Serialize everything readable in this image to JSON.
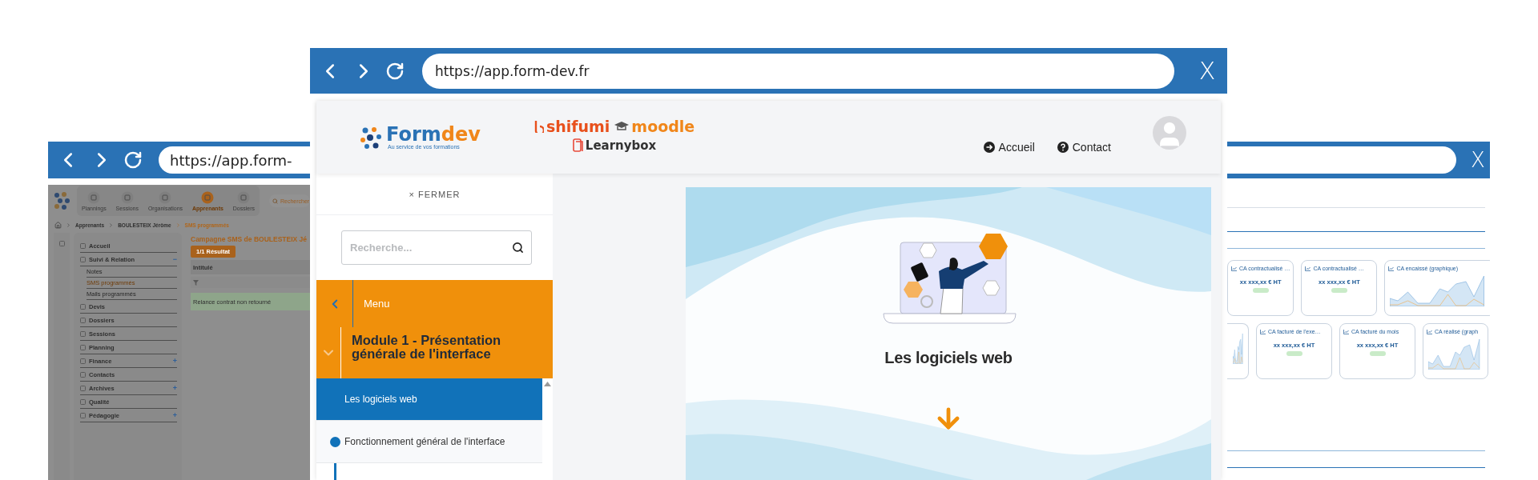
{
  "back_window": {
    "url": "https://app.form-",
    "close": "X",
    "left_app": {
      "nav": [
        {
          "label": "Plannings",
          "selected": false
        },
        {
          "label": "Sessions",
          "selected": false
        },
        {
          "label": "Organisations",
          "selected": false
        },
        {
          "label": "Apprenants",
          "selected": true
        },
        {
          "label": "Dossiers",
          "selected": false
        }
      ],
      "search_placeholder": "Rechercher",
      "breadcrumb": [
        {
          "label": "Apprenants",
          "selected": false
        },
        {
          "label": "BOULESTEIX Jérôme",
          "selected": false
        },
        {
          "label": "SMS programmés",
          "selected": true
        }
      ],
      "sidebar": [
        {
          "label": "Accueil"
        },
        {
          "label": "Suivi & Relation",
          "toggle": "−",
          "children": [
            {
              "label": "Notes",
              "selected": false
            },
            {
              "label": "SMS programmés",
              "selected": true
            },
            {
              "label": "Mails programmés",
              "selected": false
            }
          ]
        },
        {
          "label": "Devis"
        },
        {
          "label": "Dossiers"
        },
        {
          "label": "Sessions"
        },
        {
          "label": "Planning"
        },
        {
          "label": "Finance",
          "toggle": "+"
        },
        {
          "label": "Contacts"
        },
        {
          "label": "Archives",
          "toggle": "+"
        },
        {
          "label": "Qualité"
        },
        {
          "label": "Pédagogie",
          "toggle": "+"
        }
      ],
      "title": "Campagne SMS de BOULESTEIX Jé",
      "result_button": "1/1 Résultat",
      "table": {
        "columns": [
          "Intitulé"
        ],
        "rows": [
          {
            "cells": [
              "Relance contrat non retourné"
            ],
            "selected": true
          }
        ]
      }
    },
    "right_app": {
      "card_rows": [
        [
          {
            "kind": "value",
            "title": "CA contractualisé …",
            "value": "xx xxx,xx € HT"
          },
          {
            "kind": "value",
            "title": "CA contractualisé …",
            "value": "xx xxx,xx € HT"
          },
          {
            "kind": "chart",
            "title": "CA encaissé (graphique)"
          }
        ],
        [
          {
            "kind": "chart"
          },
          {
            "kind": "value",
            "title": "CA facturé de l'exe…",
            "value": "xx xxx,xx € HT"
          },
          {
            "kind": "value",
            "title": "CA facturé du mois",
            "value": "xx xxx,xx € HT"
          },
          {
            "kind": "chart",
            "title": "CA réalisé (graph"
          }
        ]
      ]
    }
  },
  "front_window": {
    "url": "https://app.form-dev.fr",
    "close": "X",
    "header": {
      "logo": {
        "part1": "Form",
        "part2": "dev",
        "tagline": "Au service de vos formations"
      },
      "partners": [
        {
          "name": "shifumi",
          "kind": "swirl",
          "color": "#e8501c"
        },
        {
          "name": "moodle",
          "kind": "cap",
          "color": "#f0861a"
        },
        {
          "name": "Learnybox",
          "kind": "book",
          "color": "#333333"
        }
      ],
      "nav": [
        {
          "label": "Accueil",
          "kind": "arrow"
        },
        {
          "label": "Contact",
          "kind": "help"
        }
      ]
    },
    "sidebar": {
      "close": "× FERMER",
      "search_placeholder": "Recherche...",
      "menu": "Menu",
      "module": {
        "title": "Module 1 - Présentation générale de l'interface",
        "expanded": true
      },
      "lessons": [
        {
          "title": "Les logiciels web",
          "selected": true
        },
        {
          "title": "Fonctionnement général de l'interface",
          "selected": false
        }
      ]
    },
    "slide": {
      "title": "Les logiciels web"
    }
  }
}
